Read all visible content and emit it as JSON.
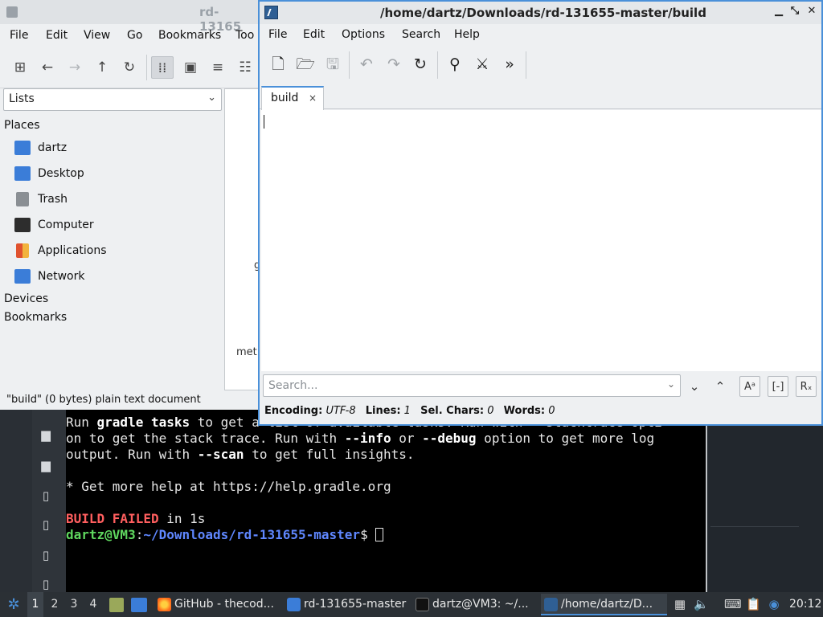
{
  "file_manager": {
    "title": "rd-13165",
    "menu": [
      "File",
      "Edit",
      "View",
      "Go",
      "Bookmarks",
      "Too"
    ],
    "side_select": "Lists",
    "places_header": "Places",
    "places": [
      {
        "label": "dartz",
        "icon": "home-folder-icon",
        "color": "#3b7dd8"
      },
      {
        "label": "Desktop",
        "icon": "desktop-icon",
        "color": "#3b7dd8"
      },
      {
        "label": "Trash",
        "icon": "trash-icon",
        "color": "#8a8f94"
      },
      {
        "label": "Computer",
        "icon": "computer-icon",
        "color": "#2d2d2d"
      },
      {
        "label": "Applications",
        "icon": "applications-icon",
        "color": "#e0522f"
      },
      {
        "label": "Network",
        "icon": "network-folder-icon",
        "color": "#3b7dd8"
      }
    ],
    "devices_header": "Devices",
    "bookmarks_header": "Bookmarks",
    "view_frag_1": "g",
    "view_frag_2": "met",
    "status": "\"build\" (0 bytes) plain text document"
  },
  "editor": {
    "title": "/home/dartz/Downloads/rd-131655-master/build",
    "menu": [
      "File",
      "Edit",
      "Options",
      "Search",
      "Help"
    ],
    "tab_label": "build",
    "tab_close": "×",
    "search_placeholder": "Search...",
    "status": {
      "encoding_label": "Encoding:",
      "encoding_value": "UTF-8",
      "lines_label": "Lines:",
      "lines_value": "1",
      "selchars_label": "Sel. Chars:",
      "selchars_value": "0",
      "words_label": "Words:",
      "words_value": "0"
    },
    "accent": "#4a90d9"
  },
  "terminal": {
    "line1_pre": "Run ",
    "line1_bold": "gradle tasks",
    "line1_post": " to get a list of available tasks. Run with --stacktrace opti",
    "line2_pre": "on to get the stack trace. Run with ",
    "line2_b1": "--info",
    "line2_mid": " or ",
    "line2_b2": "--debug",
    "line2_post": " option to get more log",
    "line3_pre": "output. Run with ",
    "line3_bold": "--scan",
    "line3_post": " to get full insights.",
    "line4": "",
    "line5": "* Get more help at https://help.gradle.org",
    "line6": "",
    "build_failed": "BUILD FAILED",
    "build_time": " in 1s",
    "prompt_user": "dartz@VM3",
    "prompt_colon": ":",
    "prompt_path": "~/Downloads/rd-131655-master",
    "prompt_dollar": "$ "
  },
  "taskbar": {
    "workspaces": [
      "1",
      "2",
      "3",
      "4"
    ],
    "tasks": [
      {
        "label": "GitHub - thecod...",
        "icon": "firefox-icon"
      },
      {
        "label": "rd-131655-master",
        "icon": "folder-icon"
      },
      {
        "label": "dartz@VM3: ~/...",
        "icon": "terminal-icon"
      },
      {
        "label": "/home/dartz/D...",
        "icon": "featherpad-icon"
      }
    ],
    "clock": "20:12"
  }
}
